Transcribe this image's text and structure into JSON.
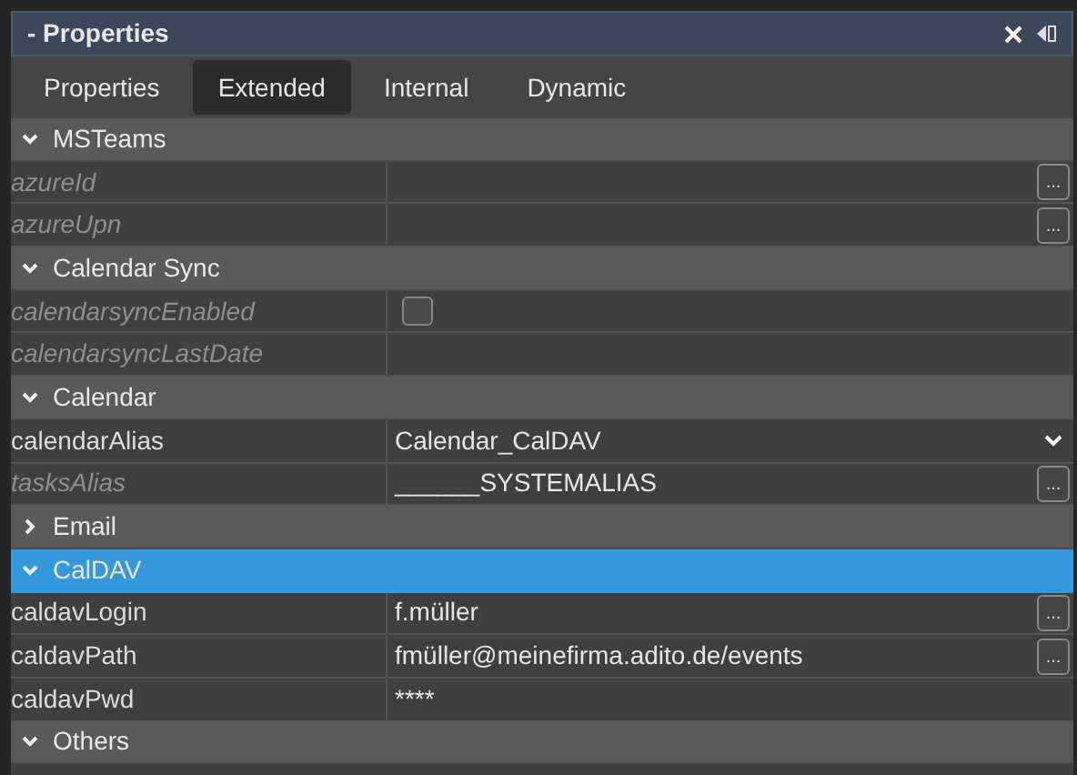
{
  "window": {
    "title": "- Properties"
  },
  "tabs": [
    {
      "label": "Properties",
      "selected": false
    },
    {
      "label": "Extended",
      "selected": true
    },
    {
      "label": "Internal",
      "selected": false
    },
    {
      "label": "Dynamic",
      "selected": false
    }
  ],
  "rows": [
    {
      "kind": "group",
      "label": "MSTeams",
      "expanded": true,
      "selected": false
    },
    {
      "kind": "property",
      "label": "azureId",
      "default": true,
      "button": "..."
    },
    {
      "kind": "property",
      "label": "azureUpn",
      "default": true,
      "button": "..."
    },
    {
      "kind": "group",
      "label": "Calendar Sync",
      "expanded": true,
      "selected": false
    },
    {
      "kind": "property",
      "label": "calendarsyncEnabled",
      "default": true,
      "checked": false
    },
    {
      "kind": "property",
      "label": "calendarsyncLastDate",
      "default": true
    },
    {
      "kind": "group",
      "label": "Calendar",
      "expanded": true,
      "selected": false
    },
    {
      "kind": "property",
      "label": "calendarAlias",
      "default": false,
      "value": "Calendar_CalDAV",
      "dropdown": true
    },
    {
      "kind": "property",
      "label": "tasksAlias",
      "default": true,
      "value": "______SYSTEMALIAS",
      "button": "..."
    },
    {
      "kind": "group",
      "label": "Email",
      "expanded": false,
      "selected": false
    },
    {
      "kind": "group",
      "label": "CalDAV",
      "expanded": true,
      "selected": true
    },
    {
      "kind": "property",
      "label": "caldavLogin",
      "default": false,
      "value": "f.müller",
      "button": "..."
    },
    {
      "kind": "property",
      "label": "caldavPath",
      "default": false,
      "value": "fmüller@meinefirma.adito.de/events",
      "button": "..."
    },
    {
      "kind": "property",
      "label": "caldavPwd",
      "default": false,
      "value": "****"
    },
    {
      "kind": "group",
      "label": "Others",
      "expanded": true,
      "selected": false
    }
  ]
}
